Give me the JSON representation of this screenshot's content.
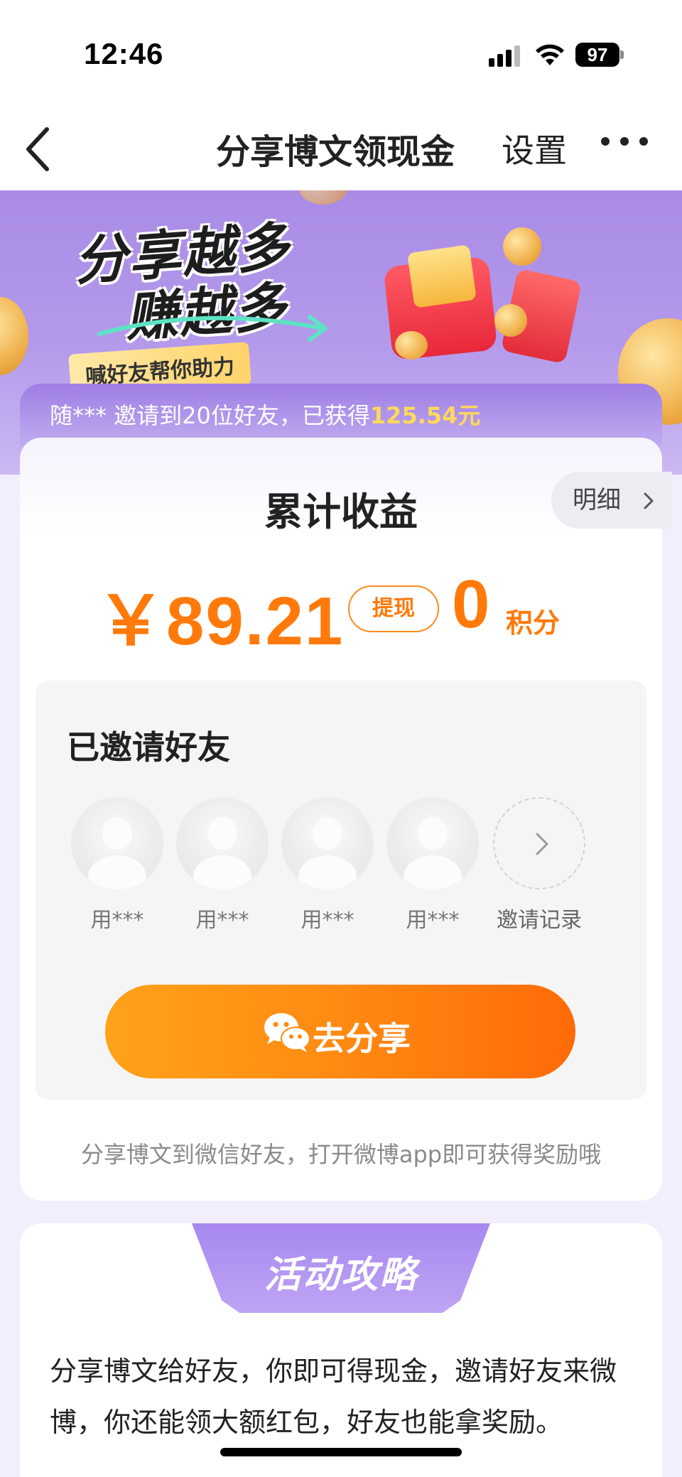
{
  "status_bar": {
    "time": "12:46",
    "battery": "97",
    "icons": [
      "signal-icon",
      "wifi-icon",
      "battery-icon"
    ]
  },
  "nav": {
    "title": "分享博文领现金",
    "settings_label": "设置",
    "back_icon": "chevron-left-icon",
    "more_icon": "more-dots-icon"
  },
  "banner": {
    "slogan_line1": "分享越多",
    "slogan_line2": "赚越多",
    "help_tag": "喊好友帮你助力"
  },
  "ticker": {
    "text": "随*** 邀请到20位好友，已获得",
    "amount": "125.54元"
  },
  "earnings": {
    "title": "累计收益",
    "detail_label": "明细",
    "amount": "￥89.21",
    "withdraw_label": "提现",
    "points": "0",
    "points_label": "积分"
  },
  "invite": {
    "title": "已邀请好友",
    "friends": [
      {
        "name": "用***"
      },
      {
        "name": "用***"
      },
      {
        "name": "用***"
      },
      {
        "name": "用***"
      }
    ],
    "record_label": "邀请记录",
    "share_button": "去分享",
    "hint": "分享博文到微信好友，打开微博app即可获得奖励哦"
  },
  "strategy": {
    "title": "活动攻略",
    "text": "分享博文给好友，你即可得现金，邀请好友来微博，你还能领大额红包，好友也能拿奖励。"
  },
  "colors": {
    "accent_orange": "#ff7a0a",
    "banner_purple": "#a98be6",
    "ticker_gold": "#ffd85c"
  }
}
